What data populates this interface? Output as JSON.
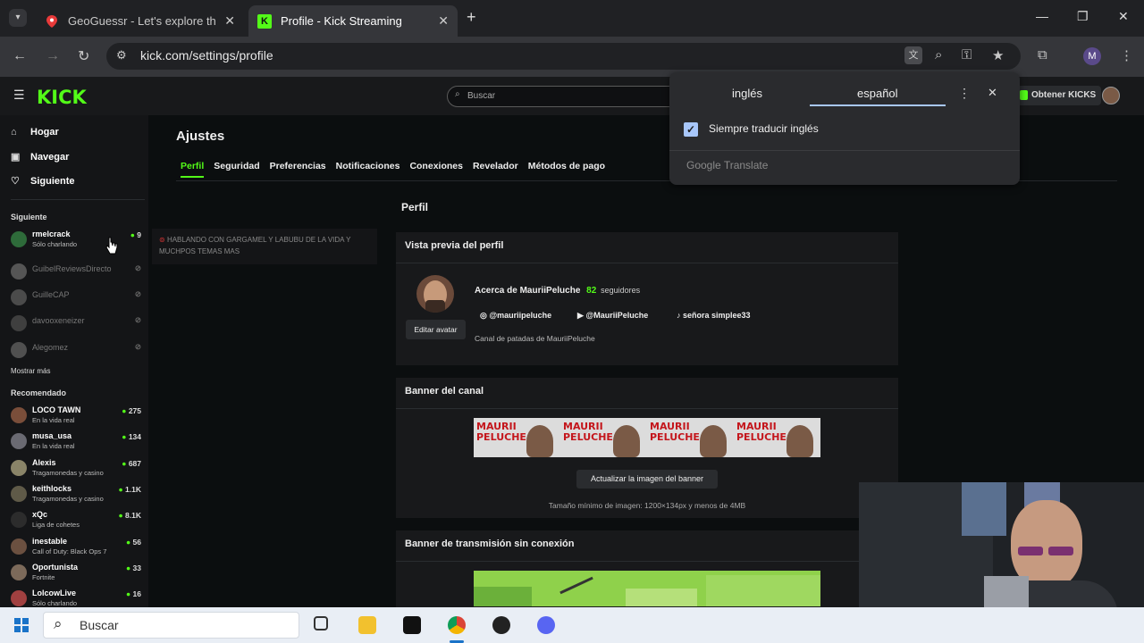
{
  "browser": {
    "tabs": [
      {
        "title": "GeoGuessr - Let's explore the w",
        "active": false
      },
      {
        "title": "Profile - Kick Streaming",
        "active": true
      }
    ],
    "new_tab": "+",
    "url": "kick.com/settings/profile",
    "profile_initial": "M"
  },
  "translate_popup": {
    "source_lang": "inglés",
    "target_lang": "español",
    "always_translate": "Siempre traducir inglés",
    "brand": "Google Translate"
  },
  "kick": {
    "logo": "KICK",
    "search_placeholder": "Buscar",
    "get_kicks": "Obtener KICKS",
    "nav": [
      {
        "label": "Hogar",
        "icon": "home-icon"
      },
      {
        "label": "Navegar",
        "icon": "browse-icon"
      },
      {
        "label": "Siguiente",
        "icon": "heart-icon"
      }
    ],
    "following_header": "Siguiente",
    "following": [
      {
        "name": "rmelcrack",
        "category": "Sólo charlando",
        "viewers": "9",
        "live": true
      },
      {
        "name": "GuibelReviewsDirecto",
        "category": "",
        "viewers": "",
        "live": false
      },
      {
        "name": "GuilleCAP",
        "category": "",
        "viewers": "",
        "live": false
      },
      {
        "name": "davooxeneizer",
        "category": "",
        "viewers": "",
        "live": false
      },
      {
        "name": "Alegomez",
        "category": "",
        "viewers": "",
        "live": false
      }
    ],
    "show_more": "Mostrar más",
    "recommended_header": "Recomendado",
    "recommended": [
      {
        "name": "LOCO TAWN",
        "category": "En la vida real",
        "viewers": "275"
      },
      {
        "name": "musa_usa",
        "category": "En la vida real",
        "viewers": "134"
      },
      {
        "name": "Alexis",
        "category": "Tragamonedas y casino",
        "viewers": "687"
      },
      {
        "name": "keithlocks",
        "category": "Tragamonedas y casino",
        "viewers": "1.1K"
      },
      {
        "name": "xQc",
        "category": "Liga de cohetes",
        "viewers": "8.1K"
      },
      {
        "name": "inestable",
        "category": "Call of Duty: Black Ops 7",
        "viewers": "56"
      },
      {
        "name": "Oportunista",
        "category": "Fortnite",
        "viewers": "33"
      },
      {
        "name": "LolcowLive",
        "category": "Sólo charlando",
        "viewers": "16"
      }
    ],
    "ticker": "HABLANDO CON GARGAMEL Y LABUBU DE LA VIDA Y MUCHPOS TEMAS MAS",
    "settings_title": "Ajustes",
    "settings_tabs": [
      "Perfil",
      "Seguridad",
      "Preferencias",
      "Notificaciones",
      "Conexiones",
      "Revelador",
      "Métodos de pago"
    ],
    "section_title": "Perfil",
    "preview": {
      "header": "Vista previa del perfil",
      "edit_avatar": "Editar avatar",
      "about": "Acerca de MauriiPeluche",
      "followers_count": "82",
      "followers_label": "seguidores",
      "instagram": "@mauriipeluche",
      "youtube": "@MauriiPeluche",
      "tiktok": "señora simplee33",
      "description": "Canal de patadas de MauriiPeluche"
    },
    "banner": {
      "header": "Banner del canal",
      "banner_text": [
        "MAURII",
        "PELUCHE"
      ],
      "update_button": "Actualizar la imagen del banner",
      "hint": "Tamaño mínimo de imagen: 1200×134px y menos de 4MB"
    },
    "offline_banner": {
      "header": "Banner de transmisión sin conexión"
    }
  },
  "taskbar": {
    "search": "Buscar"
  },
  "colors": {
    "kick_green": "#53fc18",
    "translate_accent": "#a8c7fa"
  }
}
